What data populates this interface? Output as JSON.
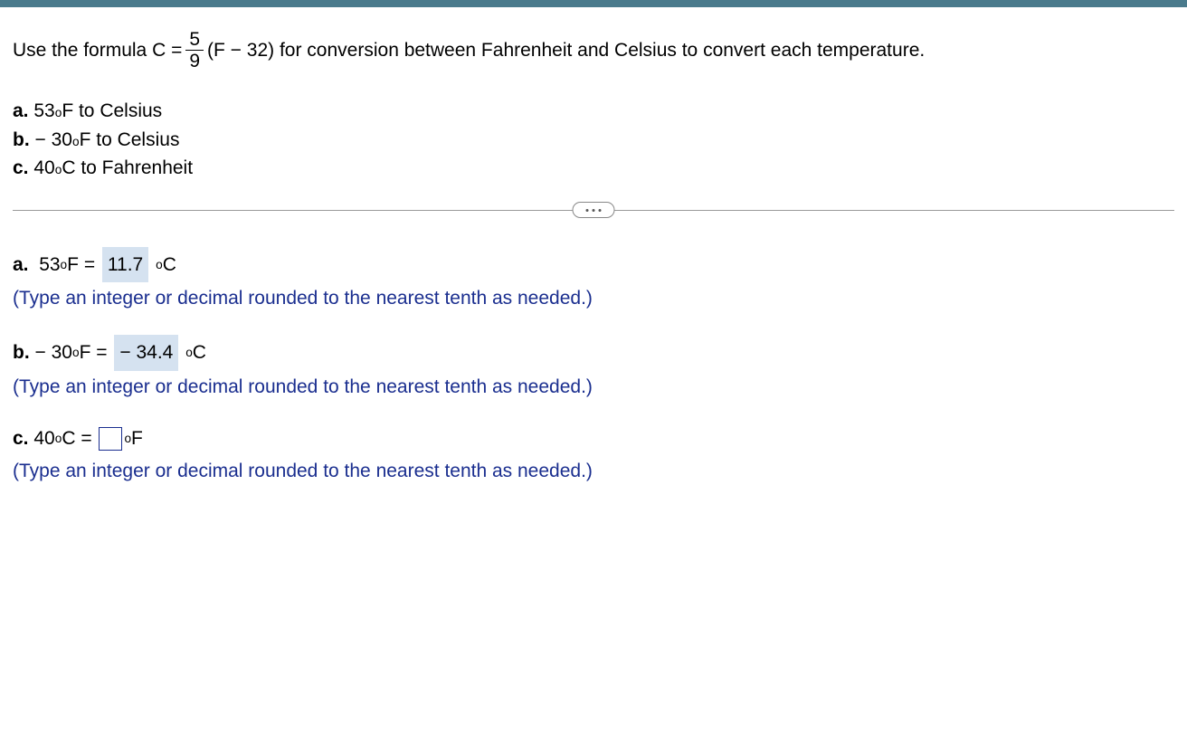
{
  "intro": {
    "prefix": "Use the formula C =",
    "frac_num": "5",
    "frac_den": "9",
    "suffix": "(F − 32) for conversion between Fahrenheit and Celsius to convert each temperature."
  },
  "parts": {
    "a": {
      "label": "a.",
      "text1": "53",
      "unit1": "F to Celsius"
    },
    "b": {
      "label": "b.",
      "neg": "− 30",
      "unit1": "F to Celsius"
    },
    "c": {
      "label": "c.",
      "text1": "40",
      "unit1": "C to Fahrenheit"
    }
  },
  "answers": {
    "a": {
      "label": "a.",
      "lhs_val": "53",
      "lhs_unit": "F",
      "eq": "=",
      "ans": "11.7",
      "rhs_unit": "C",
      "hint": "(Type an integer or decimal rounded to the nearest tenth as needed.)"
    },
    "b": {
      "label": "b.",
      "lhs_neg": "− 30",
      "lhs_unit": "F",
      "eq": "=",
      "ans": "− 34.4",
      "rhs_unit": "C",
      "hint": "(Type an integer or decimal rounded to the nearest tenth as needed.)"
    },
    "c": {
      "label": "c.",
      "lhs_val": "40",
      "lhs_unit": "C",
      "eq": "=",
      "rhs_unit": "F",
      "hint": "(Type an integer or decimal rounded to the nearest tenth as needed.)"
    }
  }
}
